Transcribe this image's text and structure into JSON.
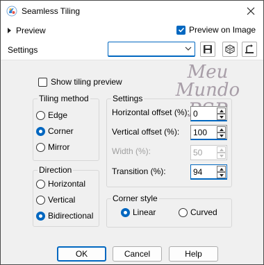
{
  "window": {
    "title": "Seamless Tiling"
  },
  "preview": {
    "label": "Preview",
    "on_image_label": "Preview on Image",
    "on_image_checked": true
  },
  "settings": {
    "label": "Settings",
    "preset_value": ""
  },
  "watermark": {
    "line1": "Meu Mundo",
    "line2": "PSP"
  },
  "show_tiling_preview": {
    "label": "Show tiling preview",
    "checked": false
  },
  "tiling_method": {
    "legend": "Tiling method",
    "options": [
      "Edge",
      "Corner",
      "Mirror"
    ],
    "selected": "Corner"
  },
  "direction": {
    "legend": "Direction",
    "options": [
      "Horizontal",
      "Vertical",
      "Bidirectional"
    ],
    "selected": "Bidirectional"
  },
  "offsets": {
    "legend": "Settings",
    "horizontal_label": "Horizontal offset (%):",
    "horizontal_value": "0",
    "vertical_label": "Vertical offset (%):",
    "vertical_value": "100",
    "width_label": "Width (%):",
    "width_value": "50",
    "transition_label": "Transition (%):",
    "transition_value": "94"
  },
  "corner_style": {
    "legend": "Corner style",
    "options": [
      "Linear",
      "Curved"
    ],
    "selected": "Linear"
  },
  "buttons": {
    "ok": "OK",
    "cancel": "Cancel",
    "help": "Help"
  },
  "colors": {
    "accent": "#0067c0",
    "dialog_bg": "#f0f0f0",
    "watermark": "#a89ea8"
  }
}
